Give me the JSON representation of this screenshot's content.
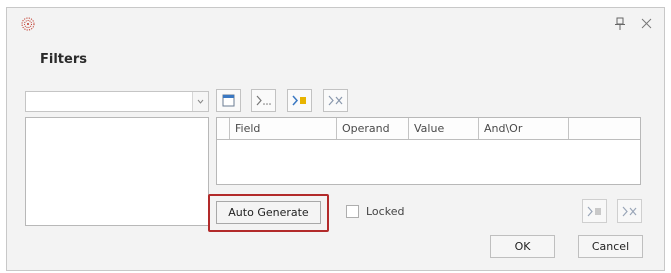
{
  "window": {
    "title": "Filters"
  },
  "toolbar": {
    "buttons": [
      {
        "name": "new-filter",
        "icon": "new-filter-icon"
      },
      {
        "name": "add-condition",
        "icon": "add-condition-icon"
      },
      {
        "name": "insert-condition",
        "icon": "insert-condition-icon"
      },
      {
        "name": "delete-condition",
        "icon": "delete-condition-icon"
      }
    ]
  },
  "grid": {
    "columns": [
      "Field",
      "Operand",
      "Value",
      "And\\Or",
      ""
    ]
  },
  "actions": {
    "auto_generate": "Auto Generate",
    "locked_label": "Locked",
    "locked_checked": false,
    "ok": "OK",
    "cancel": "Cancel"
  },
  "colors": {
    "highlight": "#b22a2a",
    "accent_yellow": "#e8b400",
    "accent_blue": "#3a78c2"
  }
}
